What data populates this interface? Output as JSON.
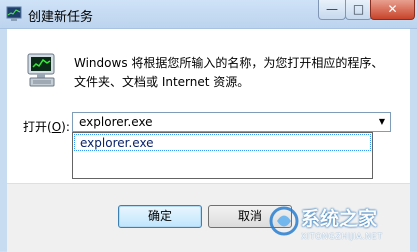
{
  "window": {
    "title": "创建新任务",
    "caption_min": "—",
    "caption_max": "□",
    "caption_close": "✕"
  },
  "main": {
    "description_line1": "Windows 将根据您所输入的名称，为您打开相应的程序、",
    "description_line2": "文件夹、文档或 Internet 资源。",
    "open_label_prefix": "打开(",
    "open_label_accel": "O",
    "open_label_suffix": "):",
    "command_value": "explorer.exe",
    "dropdown_items": [
      "explorer.exe"
    ]
  },
  "footer": {
    "ok_label": "确定",
    "cancel_label": "取消"
  },
  "watermark": {
    "brand": "系统之家",
    "url": "XITONGZHIJIA.NET"
  },
  "icons": {
    "title": "task-manager-icon",
    "run": "run-command-icon",
    "combo_arrow": "chevron-down-icon",
    "watermark": "logo-icon"
  },
  "colors": {
    "titlebar": "#cfe2f7",
    "client_bg": "#ffffff",
    "footer_bg": "#f0f0f0",
    "close_button": "#c8432a",
    "ok_button_border": "#3c7fb1"
  }
}
